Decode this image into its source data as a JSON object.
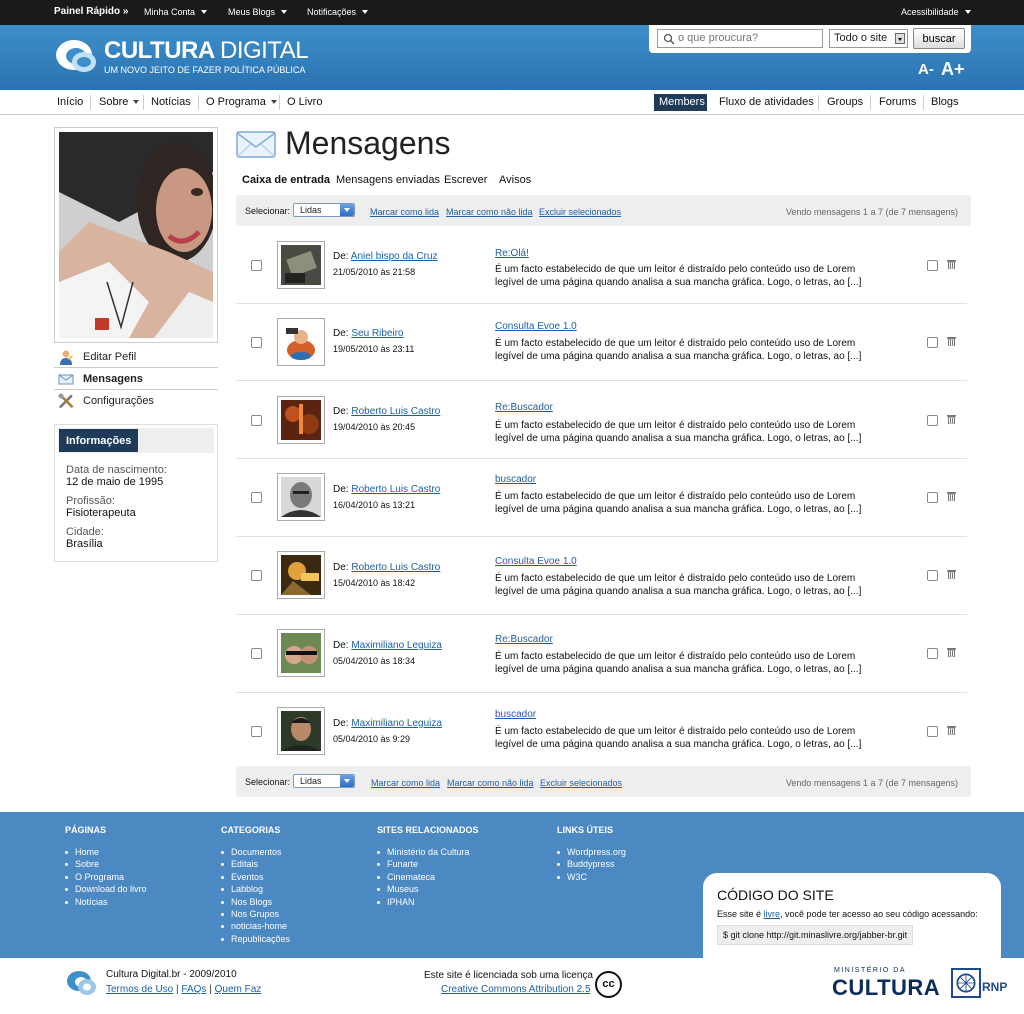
{
  "adminbar": {
    "quick_panel": "Painel Rápido »",
    "my_account": "Minha Conta",
    "my_blogs": "Meus Blogs",
    "notifications": "Notificações",
    "accessibility": "Acessibilidade"
  },
  "header": {
    "title_bold": "CULTURA",
    "title_thin": "DIGITAL",
    "tagline": "UM NOVO JEITO DE FAZER POLÍTICA PÚBLICA",
    "search_placeholder": "o que proucura?",
    "scope_selected": "Todo o site",
    "search_button": "buscar",
    "font_decrease": "A-",
    "font_increase": "A+"
  },
  "nav": {
    "left": [
      "Início",
      "Sobre",
      "Notícias",
      "O Programa",
      "O Livro"
    ],
    "right": [
      "Members",
      "Fluxo de atividades",
      "Groups",
      "Forums",
      "Blogs"
    ]
  },
  "sidebar": {
    "menu": [
      "Editar Pefil",
      "Mensagens",
      "Configurações"
    ],
    "info_title": "Informações",
    "info": [
      {
        "label": "Data de nascimento:",
        "value": "12 de maio de 1995"
      },
      {
        "label": "Profissão:",
        "value": "Fisioterapeuta"
      },
      {
        "label": "Cidade:",
        "value": "Brasília"
      }
    ]
  },
  "main": {
    "title": "Mensagens",
    "tabs": [
      "Caixa de entrada",
      "Mensagens enviadas",
      "Escrever",
      "Avisos"
    ],
    "toolbar": {
      "select_label": "Selecionar:",
      "select_value": "Lidas",
      "mark_read": "Marcar como lida",
      "mark_unread": "Marcar como não lida",
      "delete_selected": "Excluir selecionados",
      "count": "Vendo mensagens 1 a 7 (de 7 mensagens)"
    },
    "from_prefix": "De:",
    "excerpt_line1": "É um facto estabelecido de que um leitor é distraído pelo conteúdo uso de Lorem",
    "excerpt_line2": "legível de uma página quando analisa a sua mancha gráfica. Logo, o letras,    ao [...]",
    "messages": [
      {
        "from": "Aniel bispo da Cruz",
        "date": "21/05/2010 às 21:58",
        "subject": "Re:Olá!"
      },
      {
        "from": "Seu Ribeiro",
        "date": "19/05/2010 às 23:11",
        "subject": "Consulta Evoe 1.0"
      },
      {
        "from": "Roberto Luis Castro",
        "date": "19/04/2010 às 20:45",
        "subject": "Re:Buscador"
      },
      {
        "from": "Roberto Luis Castro",
        "date": "16/04/2010 às 13:21",
        "subject": "buscador"
      },
      {
        "from": "Roberto Luis Castro",
        "date": "15/04/2010 às 18:42",
        "subject": "Consulta Evoe 1.0"
      },
      {
        "from": "Maximiliano Leguiza",
        "date": "05/04/2010 às 18:34",
        "subject": "Re:Buscador"
      },
      {
        "from": "Maximiliano Leguiza",
        "date": "05/04/2010 às 9:29",
        "subject": "buscador"
      }
    ]
  },
  "footer": {
    "columns": [
      {
        "title": "PÁGINAS",
        "items": [
          "Home",
          "Sobre",
          "O Programa",
          "Download do livro",
          "Notícias"
        ]
      },
      {
        "title": "CATEGORIAS",
        "items": [
          "Documentos",
          "Editais",
          "Eventos",
          "Labblog",
          "Nos Blogs",
          "Nos Grupos",
          "noticias-home",
          "Republicações"
        ]
      },
      {
        "title": "SITES RELACIONADOS",
        "items": [
          "Ministério da Cultura",
          "Funarte",
          "Cinemateca",
          "Museus",
          "IPHAN"
        ]
      },
      {
        "title": "LINKS ÚTEIS",
        "items": [
          "Wordpress.org",
          "Buddypress",
          "W3C"
        ]
      }
    ],
    "code_title": "CÓDIGO DO SITE",
    "code_text_before": "Esse site é ",
    "code_text_link": "livre",
    "code_text_after": ", você pode ter acesso ao seu código acessando:",
    "code_cmd": "$ git clone http://git.minaslivre.org/jabber-br.git"
  },
  "bottom": {
    "credit": "Cultura Digital.br -  2009/2010",
    "links": [
      "Termos de Uso",
      "FAQs",
      "Quem Faz"
    ],
    "license_text": "Este site é licenciada sob uma licença",
    "license_link": "Creative Commons Attribution 2.5",
    "cc_badge": "cc",
    "ministry_small": "MINISTÉRIO DA",
    "ministry_big": "CULTURA",
    "rnp": "RNP"
  },
  "colors": {
    "header_blue": "#2f7cbd",
    "footer_blue": "#4c88c2",
    "dark_navy": "#1e3b5a",
    "link_blue": "#1d5fa8"
  },
  "icons": [
    "search-icon",
    "envelope-icon",
    "user-edit-icon",
    "mail-icon",
    "tools-icon",
    "trash-icon",
    "logo-icon",
    "rnp-logo-icon"
  ]
}
